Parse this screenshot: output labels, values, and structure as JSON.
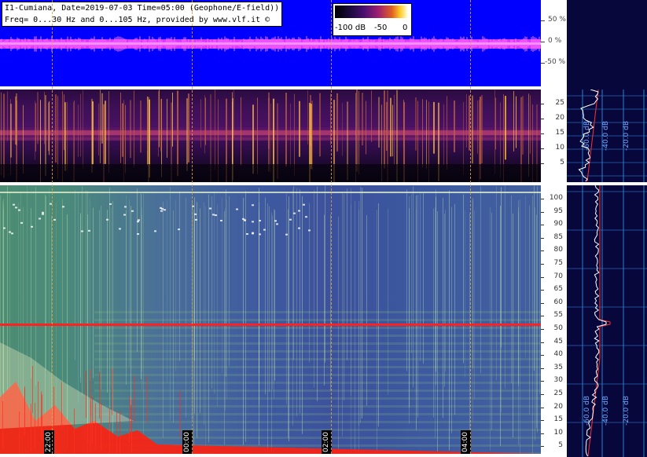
{
  "header": {
    "line1": "I1-Cumiana, Date=2019-07-03 Time=05:00 (Geophone/E-field))",
    "line2": "Freq= 0...30 Hz and 0...105 Hz, provided by www.vlf.it ©"
  },
  "colour_scale": {
    "min_label": "-100 dB",
    "mid_label": "-50",
    "max_label": "0"
  },
  "waveform_axis": [
    "50 %",
    "0 %",
    "-50 %"
  ],
  "upper_freq_axis": [
    "25",
    "20",
    "15",
    "10",
    "5"
  ],
  "lower_freq_axis": [
    "100",
    "95",
    "90",
    "85",
    "80",
    "75",
    "70",
    "65",
    "60",
    "55",
    "50",
    "45",
    "40",
    "35",
    "30",
    "25",
    "20",
    "15",
    "10",
    "5"
  ],
  "time_labels": [
    "22:00",
    "00:00",
    "02:00",
    "04:00"
  ],
  "side_upper_db": [
    "-60.0 dB",
    "-40.0 dB",
    "-20.0 dB"
  ],
  "side_lower_db": [
    "-60.0 dB",
    "-40.0 dB",
    "-20.0 dB"
  ],
  "colors": {
    "waveform_bg": "#0000ff",
    "waveform_trace": "#ff40ff",
    "mains_line": "#ff2020",
    "side_bg": "#07073c",
    "grid": "#2a7fd0"
  }
}
